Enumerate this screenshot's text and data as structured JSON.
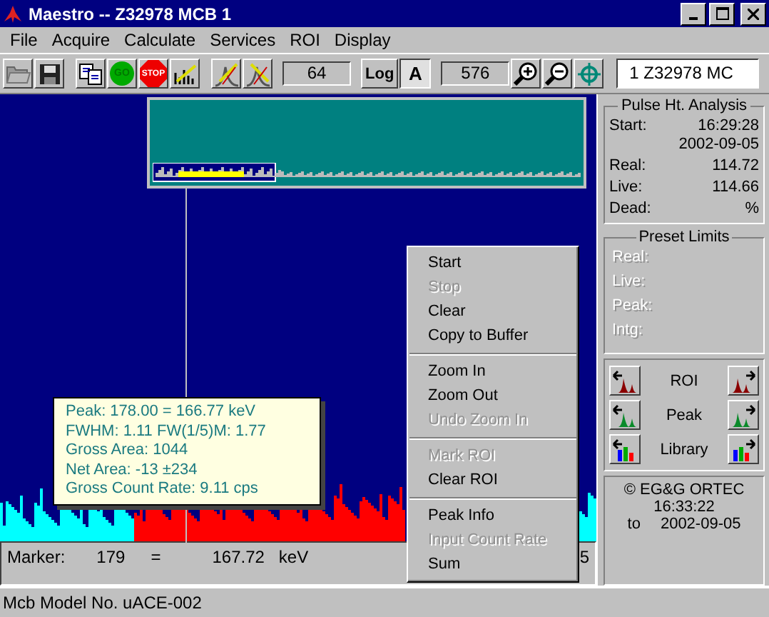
{
  "window": {
    "title": "Maestro -- Z32978 MCB 1"
  },
  "menu": [
    "File",
    "Acquire",
    "Calculate",
    "Services",
    "ROI",
    "Display"
  ],
  "toolbar": [
    {
      "kind": "open"
    },
    {
      "kind": "save"
    },
    {
      "kind": "gap"
    },
    {
      "kind": "copy"
    },
    {
      "kind": "go",
      "label": "GO"
    },
    {
      "kind": "stop",
      "label": "STOP"
    },
    {
      "kind": "spectrum"
    },
    {
      "kind": "gap"
    },
    {
      "kind": "peak-prev"
    },
    {
      "kind": "peak-next"
    },
    {
      "kind": "field",
      "label": "64"
    },
    {
      "kind": "log",
      "label": "Log"
    },
    {
      "kind": "toggle",
      "label": "A",
      "selected": true
    },
    {
      "kind": "field",
      "label": "576"
    },
    {
      "kind": "zoom-in"
    },
    {
      "kind": "zoom-out"
    },
    {
      "kind": "center"
    },
    {
      "kind": "detector",
      "label": "1 Z32978 MC"
    }
  ],
  "tooltip": [
    "Peak: 178.00 = 166.77 keV",
    "FWHM: 1.11  FW(1/5)M: 1.77",
    "Gross Area: 1044",
    "Net Area: -13 ±234",
    "Gross Count Rate: 9.11 cps"
  ],
  "context_menu": [
    [
      {
        "label": "Start",
        "disabled": false
      },
      {
        "label": "Stop",
        "disabled": true
      },
      {
        "label": "Clear",
        "disabled": false
      },
      {
        "label": "Copy to Buffer",
        "disabled": false
      }
    ],
    [
      {
        "label": "Zoom In",
        "disabled": false
      },
      {
        "label": "Zoom Out",
        "disabled": false
      },
      {
        "label": "Undo Zoom In",
        "disabled": true
      }
    ],
    [
      {
        "label": "Mark ROI",
        "disabled": true
      },
      {
        "label": "Clear ROI",
        "disabled": false
      }
    ],
    [
      {
        "label": "Peak Info",
        "disabled": false
      },
      {
        "label": "Input Count Rate",
        "disabled": true
      },
      {
        "label": "Sum",
        "disabled": false
      }
    ]
  ],
  "marker_bar": {
    "label": "Marker:",
    "channel": "179",
    "equals": "=",
    "energy": "167.72",
    "unit": "keV",
    "count": "5"
  },
  "pulse_analysis": {
    "title": "Pulse Ht. Analysis",
    "rows": [
      {
        "label": "Start:",
        "value": "16:29:28"
      },
      {
        "value": "2002-09-05"
      },
      {
        "label": "Real:",
        "value": "114.72"
      },
      {
        "label": "Live:",
        "value": "114.66"
      },
      {
        "label": "Dead:",
        "value": "%"
      }
    ]
  },
  "preset_limits": {
    "title": "Preset Limits",
    "fields": [
      {
        "label": "Real:",
        "disabled": true
      },
      {
        "label": "Live:",
        "disabled": true
      },
      {
        "label": "Peak:",
        "disabled": true
      },
      {
        "label": "Intg:",
        "disabled": true
      }
    ]
  },
  "navigation": [
    {
      "kind": "roi",
      "label": "ROI"
    },
    {
      "kind": "peak",
      "label": "Peak"
    },
    {
      "kind": "library",
      "label": "Library"
    }
  ],
  "footer": [
    "© EG&G ORTEC",
    "16:33:22",
    "to",
    "2002-09-05"
  ],
  "status_bar": "Mcb Model No. uACE-002"
}
